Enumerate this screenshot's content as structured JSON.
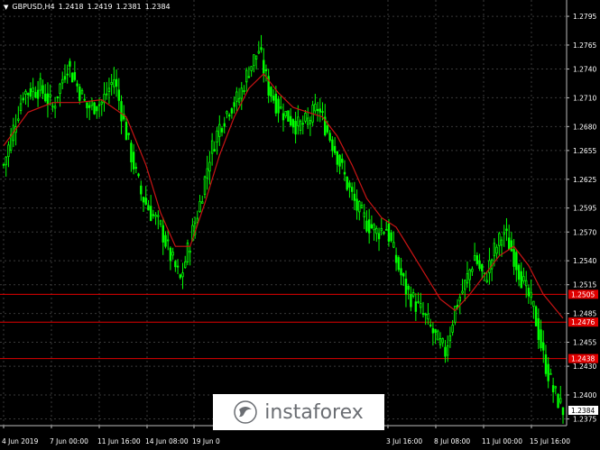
{
  "symbol": {
    "name": "GBPUSD,H4",
    "open": "1.2418",
    "high": "1.2419",
    "low": "1.2381",
    "close": "1.2384"
  },
  "watermark": {
    "text": "instaforex"
  },
  "colors": {
    "background": "#000000",
    "candle": "#00ff00",
    "ma": "#c81414",
    "level": "#e00000",
    "label_bg": "#e00000",
    "grid": "#3a3a3a"
  },
  "chart_data": {
    "type": "candlestick",
    "ylim": [
      1.2368,
      1.2812
    ],
    "y_ticks": [
      "1.2795",
      "1.2765",
      "1.2740",
      "1.2710",
      "1.2680",
      "1.2655",
      "1.2625",
      "1.2595",
      "1.2570",
      "1.2540",
      "1.2515",
      "1.2485",
      "1.2455",
      "1.2430",
      "1.2400",
      "1.2375"
    ],
    "x_ticks": [
      "4 Jun 2019",
      "7 Jun 00:00",
      "11 Jun 16:00",
      "14 Jun 08:00",
      "19 Jun 0",
      "3 Jul 16:00",
      "8 Jul 08:00",
      "11 Jul 00:00",
      "15 Jul 16:00"
    ],
    "levels": [
      {
        "value": 1.2505,
        "label": "1.2505"
      },
      {
        "value": 1.2476,
        "label": "1.2476"
      },
      {
        "value": 1.2438,
        "label": "1.2438"
      }
    ],
    "current_price": "1.2384",
    "close_path": [
      [
        0,
        1.264
      ],
      [
        8,
        1.2715
      ],
      [
        15,
        1.272
      ],
      [
        20,
        1.27
      ],
      [
        26,
        1.2745
      ],
      [
        34,
        1.27
      ],
      [
        40,
        1.2705
      ],
      [
        45,
        1.273
      ],
      [
        52,
        1.265
      ],
      [
        56,
        1.261
      ],
      [
        60,
        1.259
      ],
      [
        64,
        1.2575
      ],
      [
        68,
        1.2545
      ],
      [
        72,
        1.252
      ],
      [
        76,
        1.256
      ],
      [
        80,
        1.26
      ],
      [
        84,
        1.265
      ],
      [
        88,
        1.268
      ],
      [
        92,
        1.27
      ],
      [
        96,
        1.271
      ],
      [
        100,
        1.274
      ],
      [
        104,
        1.276
      ],
      [
        108,
        1.272
      ],
      [
        112,
        1.27
      ],
      [
        116,
        1.269
      ],
      [
        120,
        1.268
      ],
      [
        124,
        1.2685
      ],
      [
        128,
        1.27
      ],
      [
        132,
        1.2675
      ],
      [
        136,
        1.265
      ],
      [
        140,
        1.262
      ],
      [
        144,
        1.2595
      ],
      [
        148,
        1.258
      ],
      [
        152,
        1.257
      ],
      [
        156,
        1.2575
      ],
      [
        160,
        1.254
      ],
      [
        164,
        1.251
      ],
      [
        168,
        1.2495
      ],
      [
        172,
        1.248
      ],
      [
        176,
        1.246
      ],
      [
        180,
        1.2445
      ],
      [
        184,
        1.249
      ],
      [
        188,
        1.2515
      ],
      [
        192,
        1.2545
      ],
      [
        196,
        1.252
      ],
      [
        200,
        1.255
      ],
      [
        204,
        1.257
      ],
      [
        208,
        1.2545
      ],
      [
        212,
        1.2515
      ],
      [
        216,
        1.249
      ],
      [
        220,
        1.244
      ],
      [
        224,
        1.2405
      ],
      [
        228,
        1.2384
      ]
    ],
    "ma_path": [
      [
        0,
        1.266
      ],
      [
        10,
        1.2695
      ],
      [
        20,
        1.2705
      ],
      [
        30,
        1.2705
      ],
      [
        40,
        1.2708
      ],
      [
        50,
        1.269
      ],
      [
        58,
        1.264
      ],
      [
        64,
        1.259
      ],
      [
        70,
        1.2555
      ],
      [
        76,
        1.2555
      ],
      [
        82,
        1.26
      ],
      [
        88,
        1.265
      ],
      [
        94,
        1.269
      ],
      [
        100,
        1.272
      ],
      [
        106,
        1.2735
      ],
      [
        112,
        1.2715
      ],
      [
        118,
        1.27
      ],
      [
        124,
        1.2695
      ],
      [
        130,
        1.269
      ],
      [
        136,
        1.267
      ],
      [
        142,
        1.264
      ],
      [
        148,
        1.2605
      ],
      [
        154,
        1.2585
      ],
      [
        160,
        1.2575
      ],
      [
        166,
        1.255
      ],
      [
        172,
        1.2525
      ],
      [
        178,
        1.25
      ],
      [
        184,
        1.2488
      ],
      [
        190,
        1.2505
      ],
      [
        196,
        1.2525
      ],
      [
        202,
        1.2545
      ],
      [
        208,
        1.2555
      ],
      [
        214,
        1.2535
      ],
      [
        220,
        1.2505
      ],
      [
        228,
        1.248
      ]
    ]
  }
}
